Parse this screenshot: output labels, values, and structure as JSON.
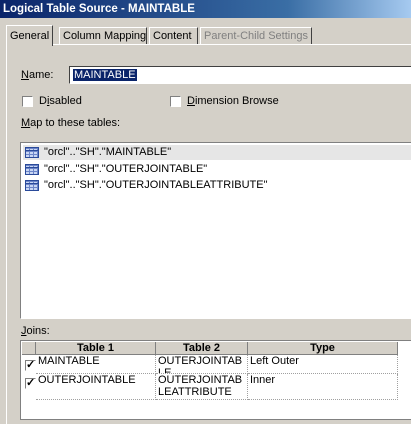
{
  "window": {
    "title": "Logical Table Source - MAINTABLE"
  },
  "tabs": [
    {
      "label": "General",
      "active": true
    },
    {
      "label": "Column Mapping",
      "active": false
    },
    {
      "label": "Content",
      "active": false
    },
    {
      "label": "Parent-Child Settings",
      "disabled": true
    }
  ],
  "general": {
    "name_label": "Name:",
    "name_value": "MAINTABLE",
    "disabled_label": "Disabled",
    "disabled_checked": false,
    "dimension_browse_label": "Dimension Browse",
    "dimension_browse_checked": false,
    "map_label": "Map to these tables:",
    "tables": [
      {
        "text": "\"orcl\"..\"SH\".\"MAINTABLE\"",
        "icon": "table-icon",
        "selected": true
      },
      {
        "text": "\"orcl\"..\"SH\".\"OUTERJOINTABLE\"",
        "icon": "table-icon",
        "selected": false
      },
      {
        "text": "\"orcl\"..\"SH\".\"OUTERJOINTABLEATTRIBUTE\"",
        "icon": "table-icon",
        "selected": false
      }
    ],
    "joins_label": "Joins:",
    "joins": {
      "columns": [
        "Table 1",
        "Table 2",
        "Type"
      ],
      "rows": [
        {
          "checked": true,
          "table1": "MAINTABLE",
          "table2": "OUTERJOINTABLE",
          "type": "Left Outer"
        },
        {
          "checked": true,
          "table1": "OUTERJOINTABLE",
          "table2": "OUTERJOINTABLEATTRIBUTE",
          "type": "Inner"
        }
      ]
    }
  },
  "colors": {
    "title_bar": "#0a246a",
    "window_bg": "#d4d0c8",
    "selection": "#0a246a"
  }
}
